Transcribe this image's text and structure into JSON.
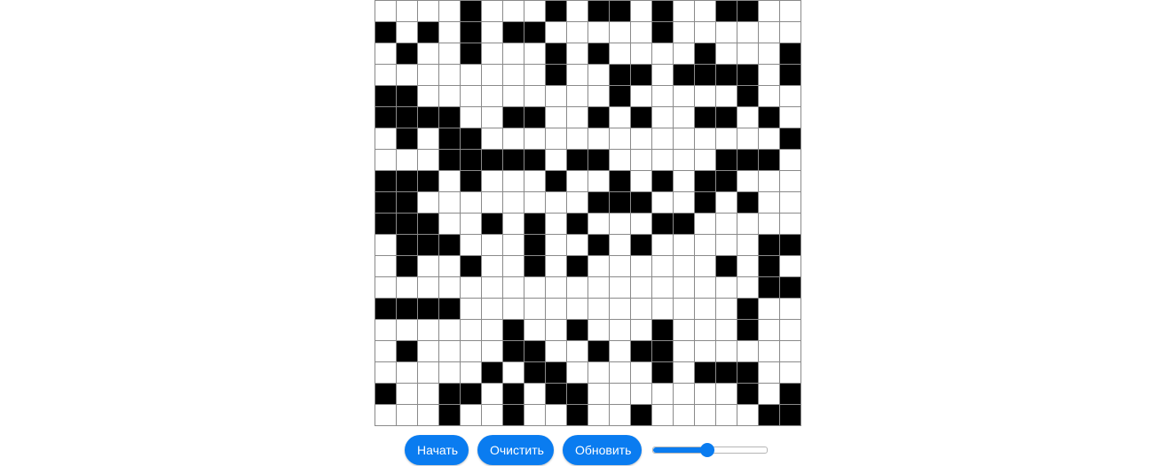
{
  "buttons": {
    "start": "Начать",
    "clear": "Очистить",
    "refresh": "Обновить"
  },
  "speed_slider": {
    "value": 0.48
  },
  "colors": {
    "alive": "#000000",
    "dead": "#ffffff",
    "grid_line": "#8a8a8a",
    "accent": "#0a7cf0"
  },
  "grid": {
    "rows": 20,
    "cols": 20,
    "cells": [
      "....#...#.##.#..##..",
      "#.#.#.##.....#......",
      ".#..#...#.#....#...#",
      "........#..##.####.#",
      "##.........#.....#..",
      "####..##..#.#..##.#.",
      ".#.##..............#",
      "...#####.##.....###.",
      "###.#...#..#.#.##...",
      "##........###..#.#..",
      "###..#.#.#...##.....",
      ".###...#..#.#.....##",
      ".#..#..#.#......#.#.",
      "..................###",
      "####.............#..",
      "......#..#...#...#..",
      ".#....##..#.##......",
      ".....#.##....#.###..",
      "#..##.#.##.......#.#",
      "...#..#..#..#.....##"
    ]
  }
}
